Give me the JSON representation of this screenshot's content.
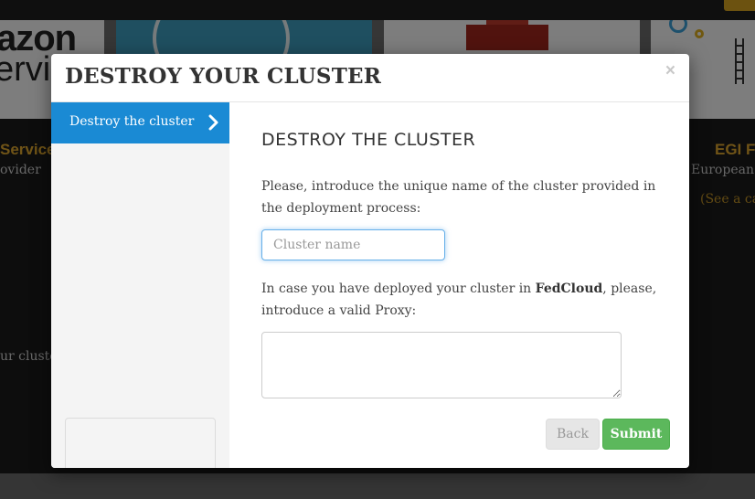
{
  "background": {
    "aws_line1": "azon",
    "aws_line2": "ervic",
    "left_heading": "Service",
    "left_sub": "ovider",
    "left_cluster_text": "ur cluster",
    "right_heading": "EGI F",
    "right_sub": "European",
    "right_link": "(See a cas"
  },
  "modal": {
    "title": "DESTROY YOUR CLUSTER",
    "close_symbol": "×",
    "sidebar": {
      "items": [
        {
          "label": "Destroy the cluster",
          "active": true
        }
      ]
    },
    "section_title": "DESTROY THE CLUSTER",
    "intro_text": "Please, introduce the unique name of the cluster provided in the deployment process:",
    "cluster_name": {
      "value": "",
      "placeholder": "Cluster name"
    },
    "proxy_text_before": "In case you have deployed your cluster in ",
    "proxy_text_bold": "FedCloud",
    "proxy_text_after": ", please, introduce a valid Proxy:",
    "proxy": {
      "value": ""
    },
    "buttons": {
      "back_label": "Back",
      "submit_label": "Submit"
    }
  },
  "colors": {
    "accent_blue": "#1a8ad4",
    "submit_green": "#5cb85c",
    "gold": "#e0a82e"
  }
}
